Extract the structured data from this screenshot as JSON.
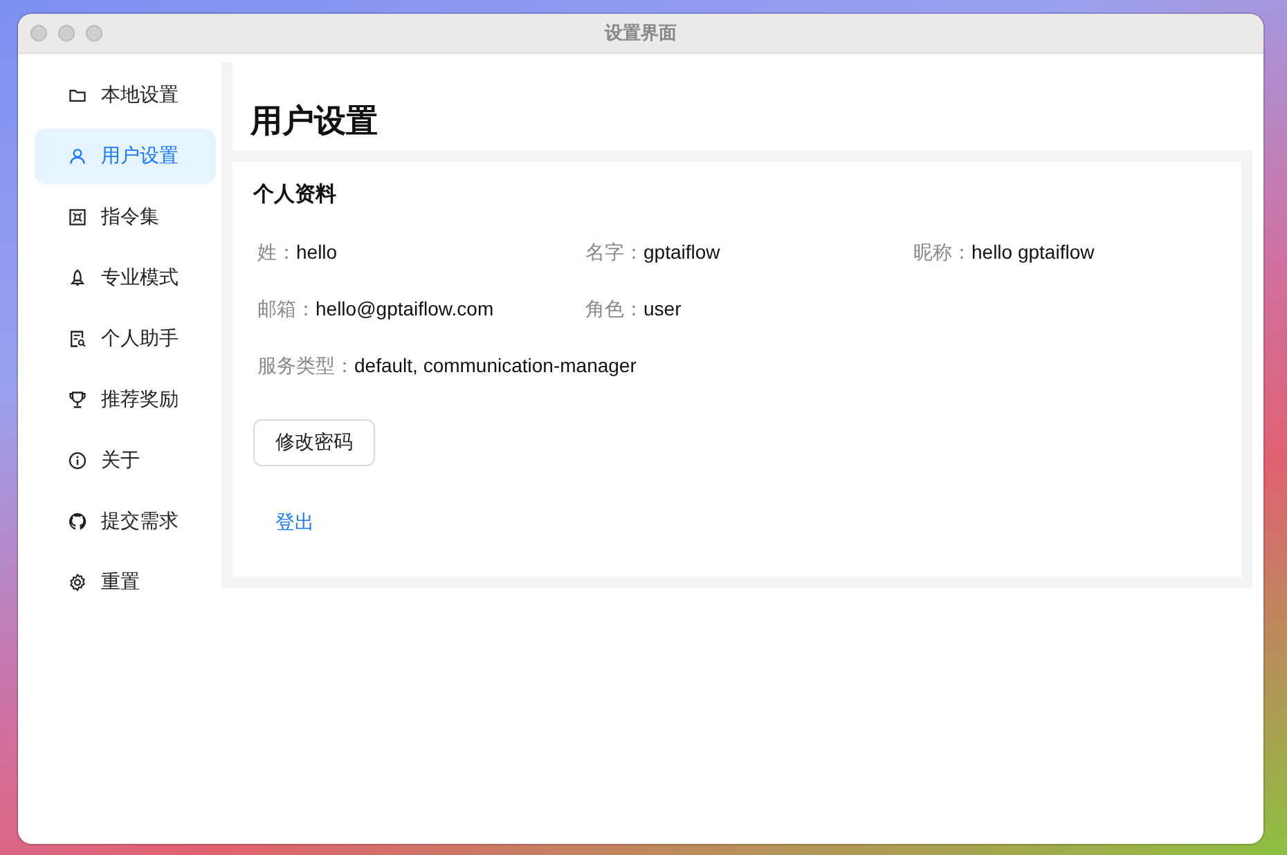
{
  "window": {
    "title": "设置界面"
  },
  "sidebar": {
    "items": [
      {
        "label": "本地设置",
        "selected": false
      },
      {
        "label": "用户设置",
        "selected": true
      },
      {
        "label": "指令集",
        "selected": false
      },
      {
        "label": "专业模式",
        "selected": false
      },
      {
        "label": "个人助手",
        "selected": false
      },
      {
        "label": "推荐奖励",
        "selected": false
      },
      {
        "label": "关于",
        "selected": false
      },
      {
        "label": "提交需求",
        "selected": false
      },
      {
        "label": "重置",
        "selected": false
      }
    ]
  },
  "page": {
    "title": "用户设置"
  },
  "profile": {
    "title": "个人资料",
    "fields": [
      {
        "label": "姓：",
        "value": "hello"
      },
      {
        "label": "名字：",
        "value": "gptaiflow"
      },
      {
        "label": "昵称：",
        "value": "hello gptaiflow"
      },
      {
        "label": "邮箱：",
        "value": "hello@gptaiflow.com"
      },
      {
        "label": "角色：",
        "value": "user"
      },
      {
        "label": "服务类型：",
        "value": "default, communication-manager"
      }
    ],
    "change_password_button": "修改密码",
    "logout_link": "登出"
  }
}
